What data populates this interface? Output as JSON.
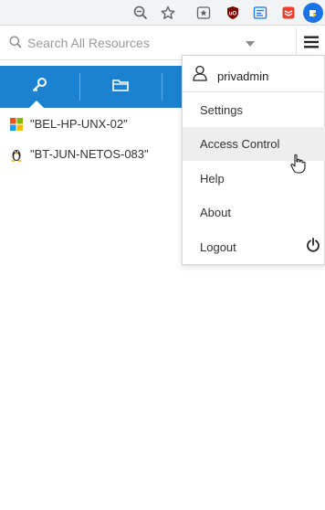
{
  "browser_toolbar": {
    "icons": [
      "zoom-out-icon",
      "bookmark-star-icon",
      "extension-shortcut-icon",
      "ublock-icon",
      "reader-extension-icon",
      "todoist-icon",
      "edge-extension-icon"
    ]
  },
  "search": {
    "placeholder": "Search All Resources",
    "icon": "search-icon"
  },
  "tabs": [
    {
      "name": "key",
      "icon": "key-icon",
      "active": true
    },
    {
      "name": "folder",
      "icon": "folder-icon",
      "active": false
    }
  ],
  "resources": [
    {
      "label": "\"BEL-HP-UNX-02\"",
      "icon": "windows-icon"
    },
    {
      "label": "\"BT-JUN-NETOS-083\"",
      "icon": "linux-icon"
    }
  ],
  "menu": {
    "username": "privadmin",
    "items": [
      {
        "label": "Settings"
      },
      {
        "label": "Access Control"
      },
      {
        "label": "Help"
      },
      {
        "label": "About"
      },
      {
        "label": "Logout"
      }
    ],
    "hovered": "Access Control"
  },
  "colors": {
    "accent": "#1a82d1",
    "menu_hover": "#eeeeee",
    "toolbar": "#f1f3f4"
  }
}
